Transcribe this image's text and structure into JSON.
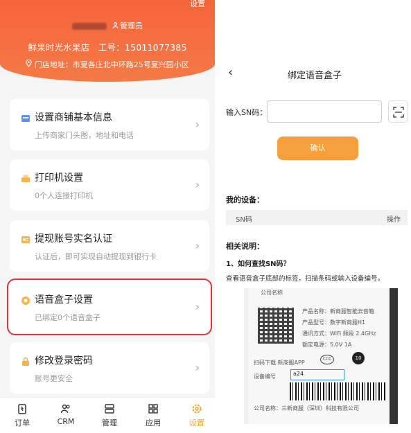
{
  "left": {
    "header": {
      "settings_label": "设置",
      "role": "管理员",
      "shop": "鲜果时光水果店",
      "staff_no_label": "工号：",
      "staff_no": "15011077385",
      "address_label": "门店地址：",
      "address": "市夏各庄北中环路25号夏兴园小区"
    },
    "cards": [
      {
        "title": "设置商铺基本信息",
        "sub": "上传商家门头图，地址和电话"
      },
      {
        "title": "打印机设置",
        "sub": "0个人连接打印机"
      },
      {
        "title": "提现账号实名认证",
        "sub": "认证后，即可实现自动提现到银行卡"
      },
      {
        "title": "语音盒子设置",
        "sub": "已绑定0个语音盒子"
      },
      {
        "title": "修改登录密码",
        "sub": "账号更安全"
      }
    ],
    "tabs": [
      {
        "label": "订单"
      },
      {
        "label": "CRM"
      },
      {
        "label": "管理"
      },
      {
        "label": "应用"
      },
      {
        "label": "设置"
      }
    ],
    "colors": {
      "accent": "#f5a623",
      "header": "#f6643a",
      "highlight": "#d9363e"
    }
  },
  "right": {
    "title": "绑定语音盒子",
    "sn_label": "输入SN码：",
    "sn_value": "",
    "confirm_label": "确认",
    "my_devices_title": "我的设备：",
    "table_headers": {
      "sn": "SN码",
      "op": "操作"
    },
    "notes_title": "相关说明：",
    "q1": "1、如何查找SN码？",
    "q1_desc": "查看语音盒子底部的标签，扫描条码或输入设备编号。",
    "label_image": {
      "company_top": "公司名称",
      "product_name": "产品名称：新商服智能云音箱",
      "model": "产品型号：数字新商服H1",
      "comm": "通讯方式：WiFi 频段 2.4GHz",
      "power": "额定电源：5.0V    1A",
      "download": "扫码下载 新商服APP",
      "ccc": "CCC",
      "ten": "10",
      "device_no_label": "设备编号",
      "device_no": "a24",
      "company_bottom": "公司名称：三新商服（深圳）科技有限公司"
    }
  }
}
